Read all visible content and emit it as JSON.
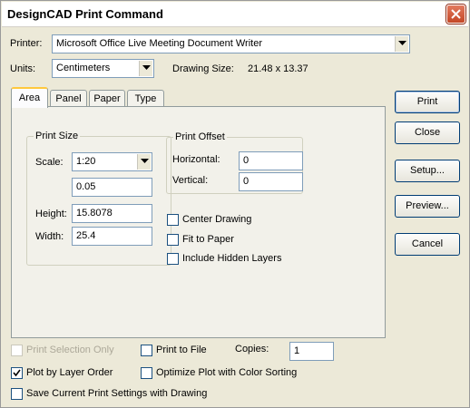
{
  "window": {
    "title": "DesignCAD Print Command"
  },
  "printer": {
    "label": "Printer:",
    "value": "Microsoft Office Live Meeting Document Writer"
  },
  "units": {
    "label": "Units:",
    "value": "Centimeters"
  },
  "drawing_size": {
    "label": "Drawing Size:",
    "value": "21.48 x 13.37"
  },
  "tabs": [
    {
      "label": "Area",
      "active": true
    },
    {
      "label": "Panel",
      "active": false
    },
    {
      "label": "Paper",
      "active": false
    },
    {
      "label": "Type",
      "active": false
    }
  ],
  "print_size": {
    "title": "Print Size",
    "scale_label": "Scale:",
    "scale_value": "1:20",
    "ratio_value": "0.05",
    "height_label": "Height:",
    "height_value": "15.8078",
    "width_label": "Width:",
    "width_value": "25.4"
  },
  "print_offset": {
    "title": "Print Offset",
    "horizontal_label": "Horizontal:",
    "horizontal_value": "0",
    "vertical_label": "Vertical:",
    "vertical_value": "0"
  },
  "options": {
    "center_drawing": {
      "label": "Center Drawing",
      "checked": false
    },
    "fit_to_paper": {
      "label": "Fit to Paper",
      "checked": false
    },
    "include_hidden_layers": {
      "label": "Include Hidden Layers",
      "checked": false
    }
  },
  "buttons": {
    "print": "Print",
    "close": "Close",
    "setup": "Setup...",
    "preview": "Preview...",
    "cancel": "Cancel"
  },
  "bottom": {
    "print_selection_only": {
      "label": "Print Selection Only",
      "checked": false,
      "disabled": true
    },
    "print_to_file": {
      "label": "Print to File",
      "checked": false
    },
    "copies_label": "Copies:",
    "copies_value": "1",
    "plot_by_layer_order": {
      "label": "Plot by Layer Order",
      "checked": true
    },
    "optimize_plot": {
      "label": "Optimize Plot with Color Sorting",
      "checked": false
    },
    "save_settings": {
      "label": "Save Current Print Settings with Drawing",
      "checked": false
    }
  },
  "colors": {
    "dialog_bg": "#ece9d8",
    "button_border": "#003c74",
    "active_tab_accent": "#ffc83c",
    "close_button": "#c44725"
  }
}
